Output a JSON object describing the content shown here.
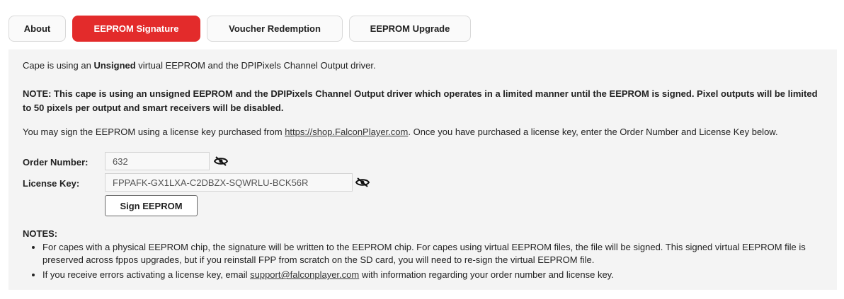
{
  "tabs": {
    "about": "About",
    "eeprom_signature": "EEPROM Signature",
    "voucher_redemption": "Voucher Redemption",
    "eeprom_upgrade": "EEPROM Upgrade",
    "active_color": "#e32b2b"
  },
  "status": {
    "prefix": "Cape is using an ",
    "state": "Unsigned",
    "suffix": " virtual EEPROM and the DPIPixels Channel Output driver."
  },
  "note": "NOTE: This cape is using an unsigned EEPROM and the DPIPixels Channel Output driver which operates in a limited manner until the EEPROM is signed. Pixel outputs will be limited to 50 pixels per output and smart receivers will be disabled.",
  "sign_info": {
    "before_link": "You may sign the EEPROM using a license key purchased from ",
    "link": "https://shop.FalconPlayer.com",
    "after_link": ". Once you have purchased a license key, enter the Order Number and License Key below."
  },
  "form": {
    "order_label": "Order Number:",
    "order_value": "632",
    "license_label": "License Key:",
    "license_value": "FPPAFK-GX1LXA-C2DBZX-SQWRLU-BCK56R",
    "visibility_icon": "eye-slash-icon",
    "sign_button": "Sign EEPROM"
  },
  "notes": {
    "title": "NOTES:",
    "item1": "For capes with a physical EEPROM chip, the signature will be written to the EEPROM chip. For capes using virtual EEPROM files, the file will be signed. This signed virtual EEPROM file is preserved across fpp​os upgrades, but if you reinstall FPP from scratch on the SD card, you will need to re-sign the virtual EEPROM file.",
    "item2_before": "If you receive errors activating a license key, email ",
    "item2_link": "support@falconplayer.com",
    "item2_after": " with information regarding your order number and license key."
  }
}
